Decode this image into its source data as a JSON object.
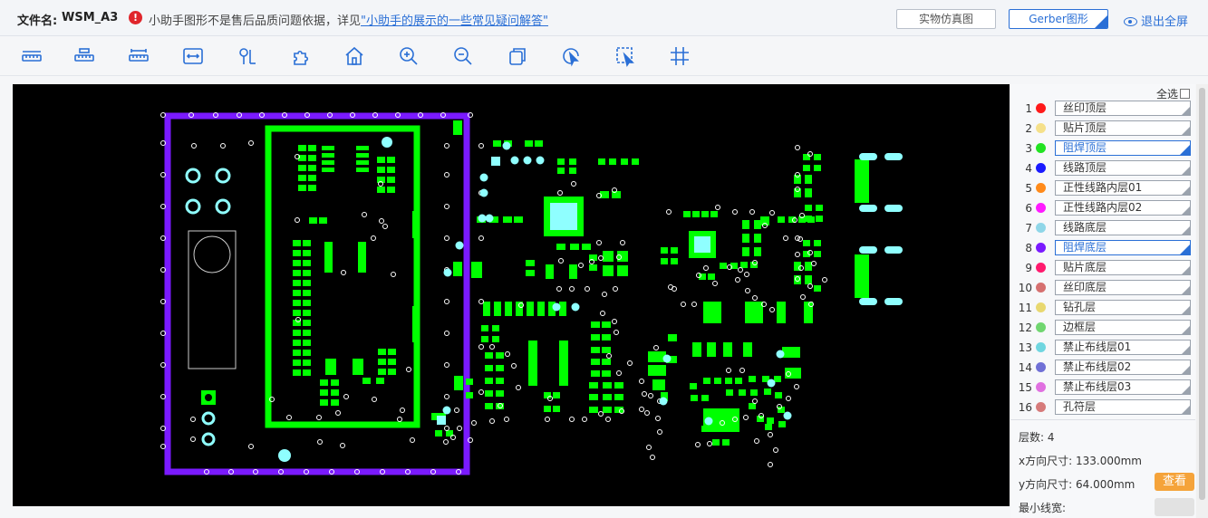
{
  "header": {
    "file_label": "文件名:",
    "file_name": "WSM_A3",
    "notice_text": "小助手图形不是售后品质问题依据，详见",
    "notice_link": "\"小助手的展示的一些常见疑问解答\"",
    "btn_real": "实物仿真图",
    "btn_gerber": "Gerber图形",
    "exit_label": "退出全屏"
  },
  "toolbar": {
    "tools": [
      "ruler-1-icon",
      "ruler-2-icon",
      "ruler-3-icon",
      "width-measure-icon",
      "pin-icon",
      "puzzle-icon",
      "home-icon",
      "zoom-in-icon",
      "zoom-out-icon",
      "copy-icon",
      "rotate-cursor-icon",
      "select-area-icon",
      "grid-icon"
    ]
  },
  "panel": {
    "select_all": "全选",
    "layers": [
      {
        "num": "1",
        "name": "丝印顶层",
        "color": "#ff1a1a",
        "active": false
      },
      {
        "num": "2",
        "name": "贴片顶层",
        "color": "#f5e08a",
        "active": false
      },
      {
        "num": "3",
        "name": "阻焊顶层",
        "color": "#22e322",
        "active": true
      },
      {
        "num": "4",
        "name": "线路顶层",
        "color": "#1a1aff",
        "active": false
      },
      {
        "num": "5",
        "name": "正性线路内层01",
        "color": "#ff8a1a",
        "active": false
      },
      {
        "num": "6",
        "name": "正性线路内层02",
        "color": "#ff1aff",
        "active": false
      },
      {
        "num": "7",
        "name": "线路底层",
        "color": "#8fd6e8",
        "active": false
      },
      {
        "num": "8",
        "name": "阻焊底层",
        "color": "#7a1aff",
        "active": true
      },
      {
        "num": "9",
        "name": "贴片底层",
        "color": "#ff1a6e",
        "active": false
      },
      {
        "num": "10",
        "name": "丝印底层",
        "color": "#d67070",
        "active": false
      },
      {
        "num": "11",
        "name": "钻孔层",
        "color": "#e8d870",
        "active": false
      },
      {
        "num": "12",
        "name": "边框层",
        "color": "#70d670",
        "active": false
      },
      {
        "num": "13",
        "name": "禁止布线层01",
        "color": "#70d6e0",
        "active": false
      },
      {
        "num": "14",
        "name": "禁止布线层02",
        "color": "#7070d6",
        "active": false
      },
      {
        "num": "15",
        "name": "禁止布线层03",
        "color": "#e070e0",
        "active": false
      },
      {
        "num": "16",
        "name": "孔符层",
        "color": "#d67a7a",
        "active": false
      }
    ],
    "layer_count_label": "层数:",
    "layer_count": "4",
    "x_size_label": "x方向尺寸:",
    "x_size": "133.000mm",
    "y_size_label": "y方向尺寸:",
    "y_size": "64.000mm",
    "view_btn": "查看",
    "min_line_label": "最小线宽:"
  },
  "colors": {
    "pad_green": "#00ff00",
    "outline_purple": "#7a1aff",
    "pad_cyan": "#8fffff",
    "accent_blue": "#2a6fd6",
    "view_orange": "#f5a33a"
  }
}
